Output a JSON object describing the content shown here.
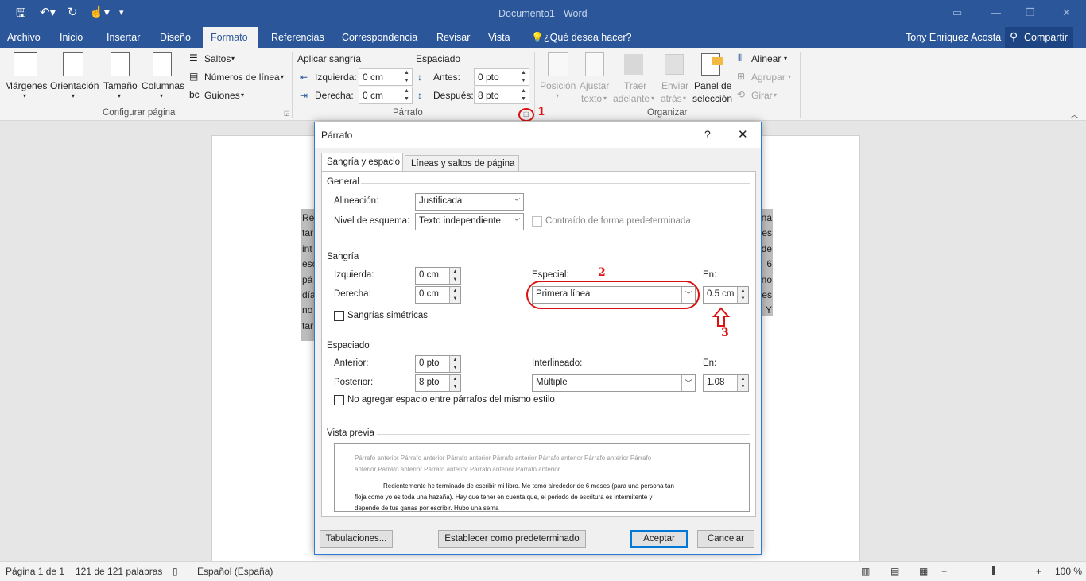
{
  "window": {
    "title": "Documento1 - Word"
  },
  "tabs": [
    "Archivo",
    "Inicio",
    "Insertar",
    "Diseño",
    "Formato",
    "Referencias",
    "Correspondencia",
    "Revisar",
    "Vista"
  ],
  "tellme": "¿Qué desea hacer?",
  "user": "Tony Enriquez Acosta",
  "share": "Compartir",
  "ribbon": {
    "page_setup": {
      "margins": "Márgenes",
      "orientation": "Orientación",
      "size": "Tamaño",
      "columns": "Columnas",
      "breaks": "Saltos",
      "line_numbers": "Números de línea",
      "hyphenation": "Guiones",
      "group": "Configurar página"
    },
    "paragraph": {
      "indent_title": "Aplicar sangría",
      "left_label": "Izquierda:",
      "left_value": "0 cm",
      "right_label": "Derecha:",
      "right_value": "0 cm",
      "spacing_title": "Espaciado",
      "before_label": "Antes:",
      "before_value": "0 pto",
      "after_label": "Después:",
      "after_value": "8 pto",
      "group": "Párrafo"
    },
    "arrange": {
      "position": "Posición",
      "wrap1": "Ajustar",
      "wrap2": "texto",
      "forward1": "Traer",
      "forward2": "adelante",
      "backward1": "Enviar",
      "backward2": "atrás",
      "pane1": "Panel de",
      "pane2": "selección",
      "align": "Alinear",
      "group_btn": "Agrupar",
      "rotate": "Girar",
      "group": "Organizar"
    }
  },
  "annotations": {
    "one": "1",
    "two": "2",
    "three": "3"
  },
  "document": {
    "left_fragments": [
      "Re",
      "tar",
      "int",
      "esc",
      "pá",
      "día",
      "no",
      "tar"
    ],
    "right_fragments": [
      "na",
      "es",
      "de",
      "6",
      "no",
      "es",
      "Y"
    ]
  },
  "dialog": {
    "title": "Párrafo",
    "help": "?",
    "close": "✕",
    "tab1": "Sangría y espacio",
    "tab2": "Líneas y saltos de página",
    "general": "General",
    "alignment_label": "Alineación:",
    "alignment_value": "Justificada",
    "outline_label": "Nivel de esquema:",
    "outline_value": "Texto independiente",
    "collapsed_label": "Contraído de forma predeterminada",
    "indent": "Sangría",
    "left_label": "Izquierda:",
    "left_value": "0 cm",
    "right_label": "Derecha:",
    "right_value": "0 cm",
    "special_label": "Especial:",
    "special_value": "Primera línea",
    "by_label": "En:",
    "by_value": "0.5 cm",
    "mirror_label": "Sangrías simétricas",
    "spacing": "Espaciado",
    "before_label": "Anterior:",
    "before_value": "0 pto",
    "after_label": "Posterior:",
    "after_value": "8 pto",
    "linespacing_label": "Interlineado:",
    "linespacing_value": "Múltiple",
    "at_label": "En:",
    "at_value": "1.08",
    "no_space_label": "No agregar espacio entre párrafos del mismo estilo",
    "preview": "Vista previa",
    "preview_prev1": "Párrafo anterior Párrafo anterior Párrafo anterior Párrafo anterior Párrafo anterior Párrafo anterior Párrafo",
    "preview_prev2": "anterior Párrafo anterior Párrafo anterior Párrafo anterior Párrafo anterior",
    "preview_text1": "Recientemente he terminado de escribir mi libro. Me tomó alrededor de 6 meses (para una persona tan",
    "preview_text2": "floja como yo es toda una hazaña). Hay que tener en cuenta que, el periodo de escritura es intermitente y",
    "preview_text3": "depende de tus ganas por escribir.  Hubo una sema",
    "tabs_btn": "Tabulaciones...",
    "default_btn": "Establecer como predeterminado",
    "ok_btn": "Aceptar",
    "cancel_btn": "Cancelar"
  },
  "status": {
    "page": "Página 1 de 1",
    "words": "121 de 121 palabras",
    "language": "Español (España)",
    "zoom": "100 %"
  }
}
